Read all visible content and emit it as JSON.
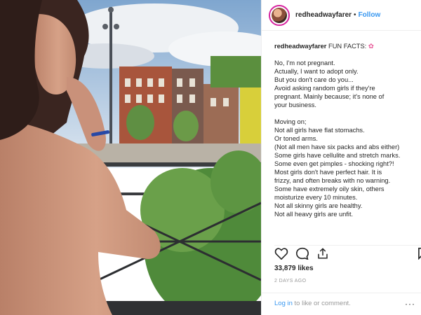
{
  "post": {
    "username": "redheadwayfarer",
    "separator": "•",
    "follow_label": "Follow",
    "caption_username": "redheadwayfarer",
    "caption_title": "FUN FACTS:",
    "caption_emoji": "✿",
    "caption_lines": [
      "No, I'm not pregnant.",
      "Actually, I want to adopt only.",
      "But you don't care do you...",
      "Avoid asking random girls if they're",
      "pregnant. Mainly because; it's none of",
      "your business.",
      "",
      "Moving on;",
      "Not all girls have flat stomachs.",
      "Or toned arms.",
      "(Not all men have six packs and abs either)",
      "Some girls have cellulite and stretch marks.",
      "Some even get pimples - shocking right?!",
      "Most girls don't have perfect hair. It is",
      "frizzy, and often breaks with no warning.",
      "Some have extremely oily skin, others",
      "moisturize every 10 minutes.",
      "Not all skinny girls are healthy.",
      "Not all heavy girls are unfit."
    ],
    "likes": "33,879 likes",
    "timestamp": "2 DAYS AGO",
    "login_link": "Log in",
    "comment_prompt": "to like or comment."
  },
  "colors": {
    "link_blue": "#3897f0",
    "text": "#262626",
    "muted": "#999999",
    "divider": "#efefef"
  },
  "icons": [
    "heart-icon",
    "comment-icon",
    "share-icon",
    "bookmark-icon",
    "more-options-icon"
  ]
}
